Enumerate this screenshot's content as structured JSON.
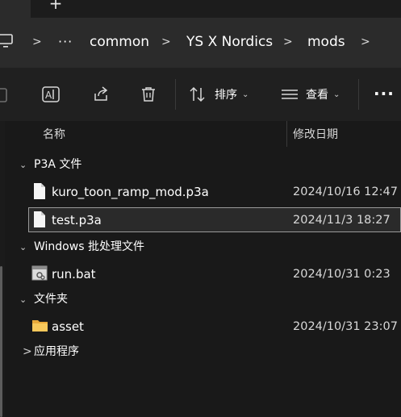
{
  "tabstrip": {
    "new_tab_glyph": "+"
  },
  "address": {
    "more_glyph": "···",
    "crumbs": [
      "common",
      "YS X Nordics",
      "mods"
    ]
  },
  "toolbar": {
    "sort_label": "排序",
    "view_label": "查看",
    "more_glyph": "···"
  },
  "columns": {
    "name": "名称",
    "modified": "修改日期"
  },
  "groups": [
    {
      "label": "P3A 文件",
      "expanded": true,
      "items": [
        {
          "name": "kuro_toon_ramp_mod.p3a",
          "date": "2024/10/16 12:47",
          "icon": "file-icon"
        },
        {
          "name": "test.p3a",
          "date": "2024/11/3 18:27",
          "icon": "file-icon",
          "selected": true
        }
      ]
    },
    {
      "label": "Windows 批处理文件",
      "expanded": true,
      "items": [
        {
          "name": "run.bat",
          "date": "2024/10/31 0:23",
          "icon": "batch-file-icon"
        }
      ]
    },
    {
      "label": "文件夹",
      "expanded": true,
      "items": [
        {
          "name": "asset",
          "date": "2024/10/31 23:07",
          "icon": "folder-icon"
        }
      ]
    },
    {
      "label": "应用程序",
      "expanded": false,
      "items": []
    }
  ],
  "colors": {
    "background": "#191919",
    "toolbar": "#202020",
    "addressbar": "#2b2b2b",
    "folder": "#f2c14e",
    "selection_border": "#9a9a9a"
  }
}
